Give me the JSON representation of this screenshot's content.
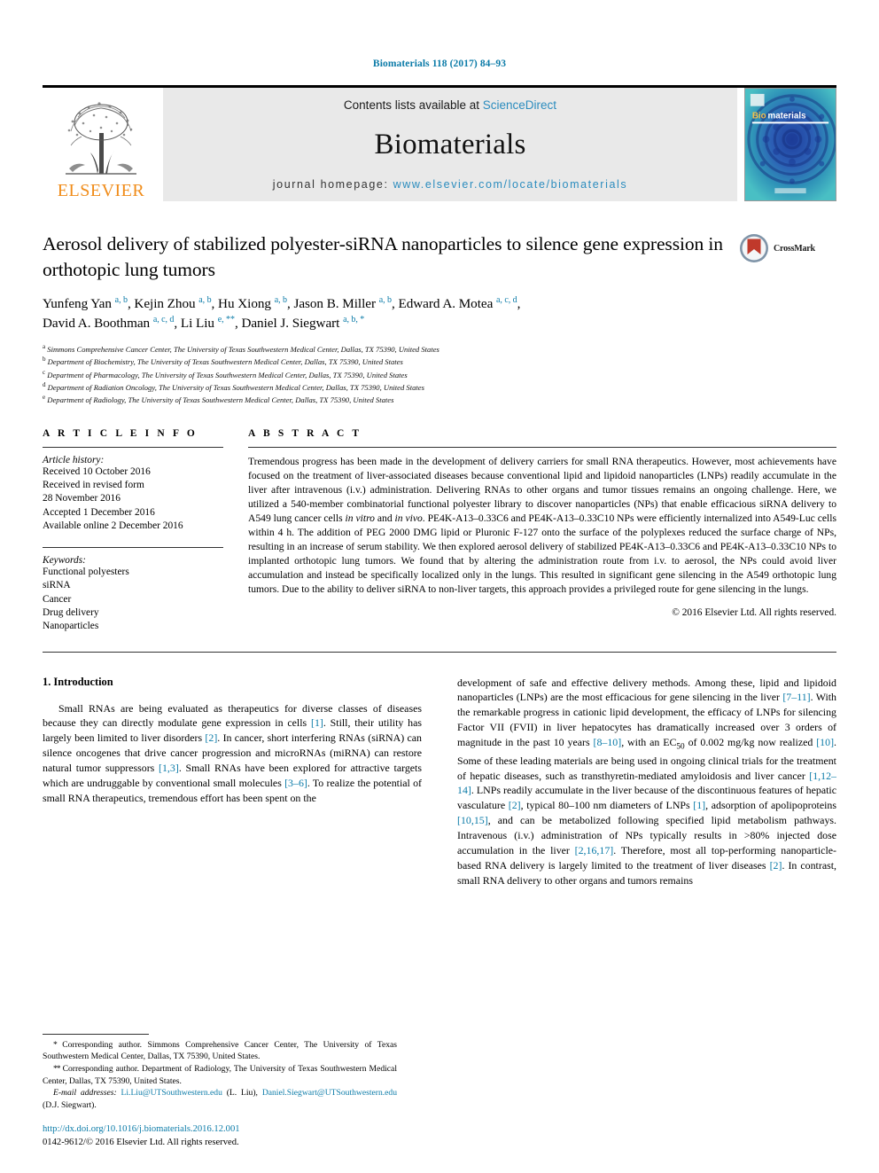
{
  "running_head": "Biomaterials 118 (2017) 84–93",
  "masthead": {
    "publisher_name": "ELSEVIER",
    "contents_prefix": "Contents lists available at",
    "contents_link": "ScienceDirect",
    "journal_title": "Biomaterials",
    "homepage_prefix": "journal homepage:",
    "homepage_url": "www.elsevier.com/locate/biomaterials",
    "cover_title_bold": "Bio",
    "cover_title_rest": "materials",
    "accent_link_color": "#2b8cbe",
    "elsevier_orange": "#f08c1a",
    "cover_bg_color": "#2aa3b5"
  },
  "article": {
    "title": "Aerosol delivery of stabilized polyester-siRNA nanoparticles to silence gene expression in orthotopic lung tumors",
    "crossmark_label": "CrossMark",
    "authors_html": "Yunfeng Yan <sup>a, b</sup>, Kejin Zhou <sup>a, b</sup>, Hu Xiong <sup>a, b</sup>, Jason B. Miller <sup>a, b</sup>, Edward A. Motea <sup>a, c, d</sup>,<br>David A. Boothman <sup>a, c, d</sup>, Li Liu <sup>e, **</sup>, Daniel J. Siegwart <sup>a, b, *</sup>",
    "affiliations": [
      {
        "mark": "a",
        "text": "Simmons Comprehensive Cancer Center, The University of Texas Southwestern Medical Center, Dallas, TX 75390, United States"
      },
      {
        "mark": "b",
        "text": "Department of Biochemistry, The University of Texas Southwestern Medical Center, Dallas, TX 75390, United States"
      },
      {
        "mark": "c",
        "text": "Department of Pharmacology, The University of Texas Southwestern Medical Center, Dallas, TX 75390, United States"
      },
      {
        "mark": "d",
        "text": "Department of Radiation Oncology, The University of Texas Southwestern Medical Center, Dallas, TX 75390, United States"
      },
      {
        "mark": "e",
        "text": "Department of Radiology, The University of Texas Southwestern Medical Center, Dallas, TX 75390, United States"
      }
    ]
  },
  "article_info": {
    "heading": "A R T I C L E  I N F O",
    "history_label": "Article history:",
    "history": [
      "Received 10 October 2016",
      "Received in revised form",
      "28 November 2016",
      "Accepted 1 December 2016",
      "Available online 2 December 2016"
    ],
    "keywords_label": "Keywords:",
    "keywords": [
      "Functional polyesters",
      "siRNA",
      "Cancer",
      "Drug delivery",
      "Nanoparticles"
    ]
  },
  "abstract": {
    "heading": "A B S T R A C T",
    "body_html": "Tremendous progress has been made in the development of delivery carriers for small RNA therapeutics. However, most achievements have focused on the treatment of liver-associated diseases because conventional lipid and lipidoid nanoparticles (LNPs) readily accumulate in the liver after intravenous (i.v.) administration. Delivering RNAs to other organs and tumor tissues remains an ongoing challenge. Here, we utilized a 540-member combinatorial functional polyester library to discover nanoparticles (NPs) that enable efficacious siRNA delivery to A549 lung cancer cells <i>in vitro</i> and <i>in vivo</i>. PE4K-A13–0.33C6 and PE4K-A13–0.33C10 NPs were efficiently internalized into A549-Luc cells within 4 h. The addition of PEG 2000 DMG lipid or Pluronic F-127 onto the surface of the polyplexes reduced the surface charge of NPs, resulting in an increase of serum stability. We then explored aerosol delivery of stabilized PE4K-A13–0.33C6 and PE4K-A13–0.33C10 NPs to implanted orthotopic lung tumors. We found that by altering the administration route from i.v. to aerosol, the NPs could avoid liver accumulation and instead be specifically localized only in the lungs. This resulted in significant gene silencing in the A549 orthotopic lung tumors. Due to the ability to deliver siRNA to non-liver targets, this approach provides a privileged route for gene silencing in the lungs.",
    "copyright": "© 2016 Elsevier Ltd. All rights reserved."
  },
  "introduction": {
    "heading": "1. Introduction",
    "left_html": "Small RNAs are being evaluated as therapeutics for diverse classes of diseases because they can directly modulate gene expression in cells <span class=\"ref\">[1]</span>. Still, their utility has largely been limited to liver disorders <span class=\"ref\">[2]</span>. In cancer, short interfering RNAs (siRNA) can silence oncogenes that drive cancer progression and microRNAs (miRNA) can restore natural tumor suppressors <span class=\"ref\">[1,3]</span>. Small RNAs have been explored for attractive targets which are undruggable by conventional small molecules <span class=\"ref\">[3–6]</span>. To realize the potential of small RNA therapeutics, tremendous effort has been spent on the",
    "right_html": "development of safe and effective delivery methods. Among these, lipid and lipidoid nanoparticles (LNPs) are the most efficacious for gene silencing in the liver <span class=\"ref\">[7–11]</span>. With the remarkable progress in cationic lipid development, the efficacy of LNPs for silencing Factor VII (FVII) in liver hepatocytes has dramatically increased over 3 orders of magnitude in the past 10 years <span class=\"ref\">[8–10]</span>, with an EC<span class=\"sub\">50</span> of 0.002 mg/kg now realized <span class=\"ref\">[10]</span>. Some of these leading materials are being used in ongoing clinical trials for the treatment of hepatic diseases, such as transthyretin-mediated amyloidosis and liver cancer <span class=\"ref\">[1,12–14]</span>. LNPs readily accumulate in the liver because of the discontinuous features of hepatic vasculature <span class=\"ref\">[2]</span>, typical 80–100 nm diameters of LNPs <span class=\"ref\">[1]</span>, adsorption of apolipoproteins <span class=\"ref\">[10,15]</span>, and can be metabolized following specified lipid metabolism pathways. Intravenous (i.v.) administration of NPs typically results in &gt;80% injected dose accumulation in the liver <span class=\"ref\">[2,16,17]</span>. Therefore, most all top-performing nanoparticle-based RNA delivery is largely limited to the treatment of liver diseases <span class=\"ref\">[2]</span>. In contrast, small RNA delivery to other organs and tumors remains"
  },
  "footnotes": {
    "corr1_html": "<span class=\"star\">*</span> Corresponding author. Simmons Comprehensive Cancer Center, The University of Texas Southwestern Medical Center, Dallas, TX 75390, United States.",
    "corr2_html": "<span class=\"star\">**</span> Corresponding author. Department of Radiology, The University of Texas Southwestern Medical Center, Dallas, TX 75390, United States.",
    "emails_html": "<i>E-mail addresses:</i> <span class=\"link\">Li.Liu@UTSouthwestern.edu</span> (L. Liu), <span class=\"link\">Daniel.Siegwart@UTSouthwestern.edu</span> (D.J. Siegwart).",
    "doi": "http://dx.doi.org/10.1016/j.biomaterials.2016.12.001",
    "issn_html": "0142-9612/© 2016 Elsevier Ltd. All rights reserved."
  }
}
